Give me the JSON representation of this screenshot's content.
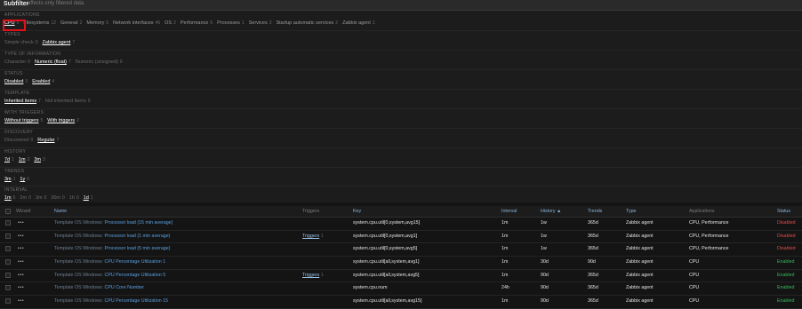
{
  "header": {
    "title": "Subfilter",
    "subtitle": "affects only filtered data"
  },
  "filters": {
    "sections": [
      {
        "label": "Applications",
        "options": [
          {
            "label": "CPU",
            "count": "6",
            "selected": true
          },
          {
            "label": "Filesystems",
            "count": "12"
          },
          {
            "label": "General",
            "count": "2"
          },
          {
            "label": "Memory",
            "count": "5"
          },
          {
            "label": "Network interfaces",
            "count": "46"
          },
          {
            "label": "OS",
            "count": "2"
          },
          {
            "label": "Performance",
            "count": "6"
          },
          {
            "label": "Processes",
            "count": "1"
          },
          {
            "label": "Services",
            "count": "3"
          },
          {
            "label": "Startup automatic services",
            "count": "2"
          },
          {
            "label": "Zabbix agent",
            "count": "1"
          }
        ]
      },
      {
        "label": "Types",
        "options": [
          {
            "label": "Simple check",
            "count": "0",
            "dim": true
          },
          {
            "label": "Zabbix agent",
            "count": "7",
            "selected": true
          }
        ]
      },
      {
        "label": "Type of information",
        "options": [
          {
            "label": "Character",
            "count": "0",
            "dim": true
          },
          {
            "label": "Numeric (float)",
            "count": "7",
            "selected": true
          },
          {
            "label": "Numeric (unsigned)",
            "count": "0",
            "dim": true
          }
        ]
      },
      {
        "label": "Status",
        "options": [
          {
            "label": "Disabled",
            "count": "3",
            "selected": true
          },
          {
            "label": "Enabled",
            "count": "4",
            "selected": true
          }
        ]
      },
      {
        "label": "Template",
        "options": [
          {
            "label": "Inherited items",
            "count": "7",
            "selected": true
          },
          {
            "label": "Not inherited items",
            "count": "0",
            "dim": true
          }
        ]
      },
      {
        "label": "With triggers",
        "options": [
          {
            "label": "Without triggers",
            "count": "5",
            "selected": true
          },
          {
            "label": "With triggers",
            "count": "2",
            "selected": true
          }
        ]
      },
      {
        "label": "Discovery",
        "options": [
          {
            "label": "Discovered",
            "count": "0",
            "dim": true
          },
          {
            "label": "Regular",
            "count": "7",
            "selected": true
          }
        ]
      },
      {
        "label": "History",
        "options": [
          {
            "label": "7d",
            "count": "1",
            "selected": true
          },
          {
            "label": "1m",
            "count": "3",
            "selected": true
          },
          {
            "label": "3m",
            "count": "3",
            "selected": true
          }
        ]
      },
      {
        "label": "Trends",
        "options": [
          {
            "label": "3m",
            "count": "1",
            "selected": true
          },
          {
            "label": "1y",
            "count": "6",
            "selected": true
          }
        ]
      },
      {
        "label": "Interval",
        "options": [
          {
            "label": "1m",
            "count": "6",
            "selected": true
          },
          {
            "label": "2m",
            "count": "0",
            "dim": true
          },
          {
            "label": "3m",
            "count": "0",
            "dim": true
          },
          {
            "label": "30m",
            "count": "0",
            "dim": true
          },
          {
            "label": "1h",
            "count": "0",
            "dim": true
          },
          {
            "label": "1d",
            "count": "1",
            "selected": true
          }
        ]
      }
    ]
  },
  "table": {
    "headers": {
      "wizard": "Wizard",
      "name": "Name",
      "triggers": "Triggers",
      "key": "Key",
      "interval": "Interval",
      "history": "History ▲",
      "trends": "Trends",
      "type": "Type",
      "applications": "Applications",
      "status": "Status"
    },
    "rows": [
      {
        "template": "Template OS Windows:",
        "name": "Processor load (15 min average)",
        "triggers": "",
        "trig_count": "",
        "key": "system.cpu.util[0,system,avg15]",
        "interval": "1m",
        "history": "1w",
        "trends": "365d",
        "type": "Zabbix agent",
        "applications": "CPU, Performance",
        "status": "Disabled"
      },
      {
        "template": "Template OS Windows:",
        "name": "Processor load (1 min average)",
        "triggers": "Triggers",
        "trig_count": "1",
        "key": "system.cpu.util[0,system,avg1]",
        "interval": "1m",
        "history": "1w",
        "trends": "365d",
        "type": "Zabbix agent",
        "applications": "CPU, Performance",
        "status": "Disabled"
      },
      {
        "template": "Template OS Windows:",
        "name": "Processor load (5 min average)",
        "triggers": "",
        "trig_count": "",
        "key": "system.cpu.util[0,system,avg5]",
        "interval": "1m",
        "history": "1w",
        "trends": "365d",
        "type": "Zabbix agent",
        "applications": "CPU, Performance",
        "status": "Disabled"
      },
      {
        "template": "Template OS Windows:",
        "name": "CPU Percentage Utilization 1",
        "triggers": "",
        "trig_count": "",
        "key": "system.cpu.util[all,system,avg1]",
        "interval": "1m",
        "history": "30d",
        "trends": "90d",
        "type": "Zabbix agent",
        "applications": "CPU",
        "status": "Enabled"
      },
      {
        "template": "Template OS Windows:",
        "name": "CPU Percentage Utilization 5",
        "triggers": "Triggers",
        "trig_count": "1",
        "key": "system.cpu.util[all,system,avg5]",
        "interval": "1m",
        "history": "90d",
        "trends": "365d",
        "type": "Zabbix agent",
        "applications": "CPU",
        "status": "Enabled"
      },
      {
        "template": "Template OS Windows:",
        "name": "CPU Core Number",
        "triggers": "",
        "trig_count": "",
        "key": "system.cpu.num",
        "interval": "24h",
        "history": "90d",
        "trends": "365d",
        "type": "Zabbix agent",
        "applications": "CPU",
        "status": "Enabled"
      },
      {
        "template": "Template OS Windows:",
        "name": "CPU Percentage Utilization 15",
        "triggers": "",
        "trig_count": "",
        "key": "system.cpu.util[all,system,avg15]",
        "interval": "1m",
        "history": "90d",
        "trends": "365d",
        "type": "Zabbix agent",
        "applications": "CPU",
        "status": "Enabled"
      }
    ]
  },
  "colors": {
    "highlight": "#e3101a",
    "enabled": "#3bb85f",
    "disabled": "#e24b4b",
    "link": "#5aa0e0"
  }
}
